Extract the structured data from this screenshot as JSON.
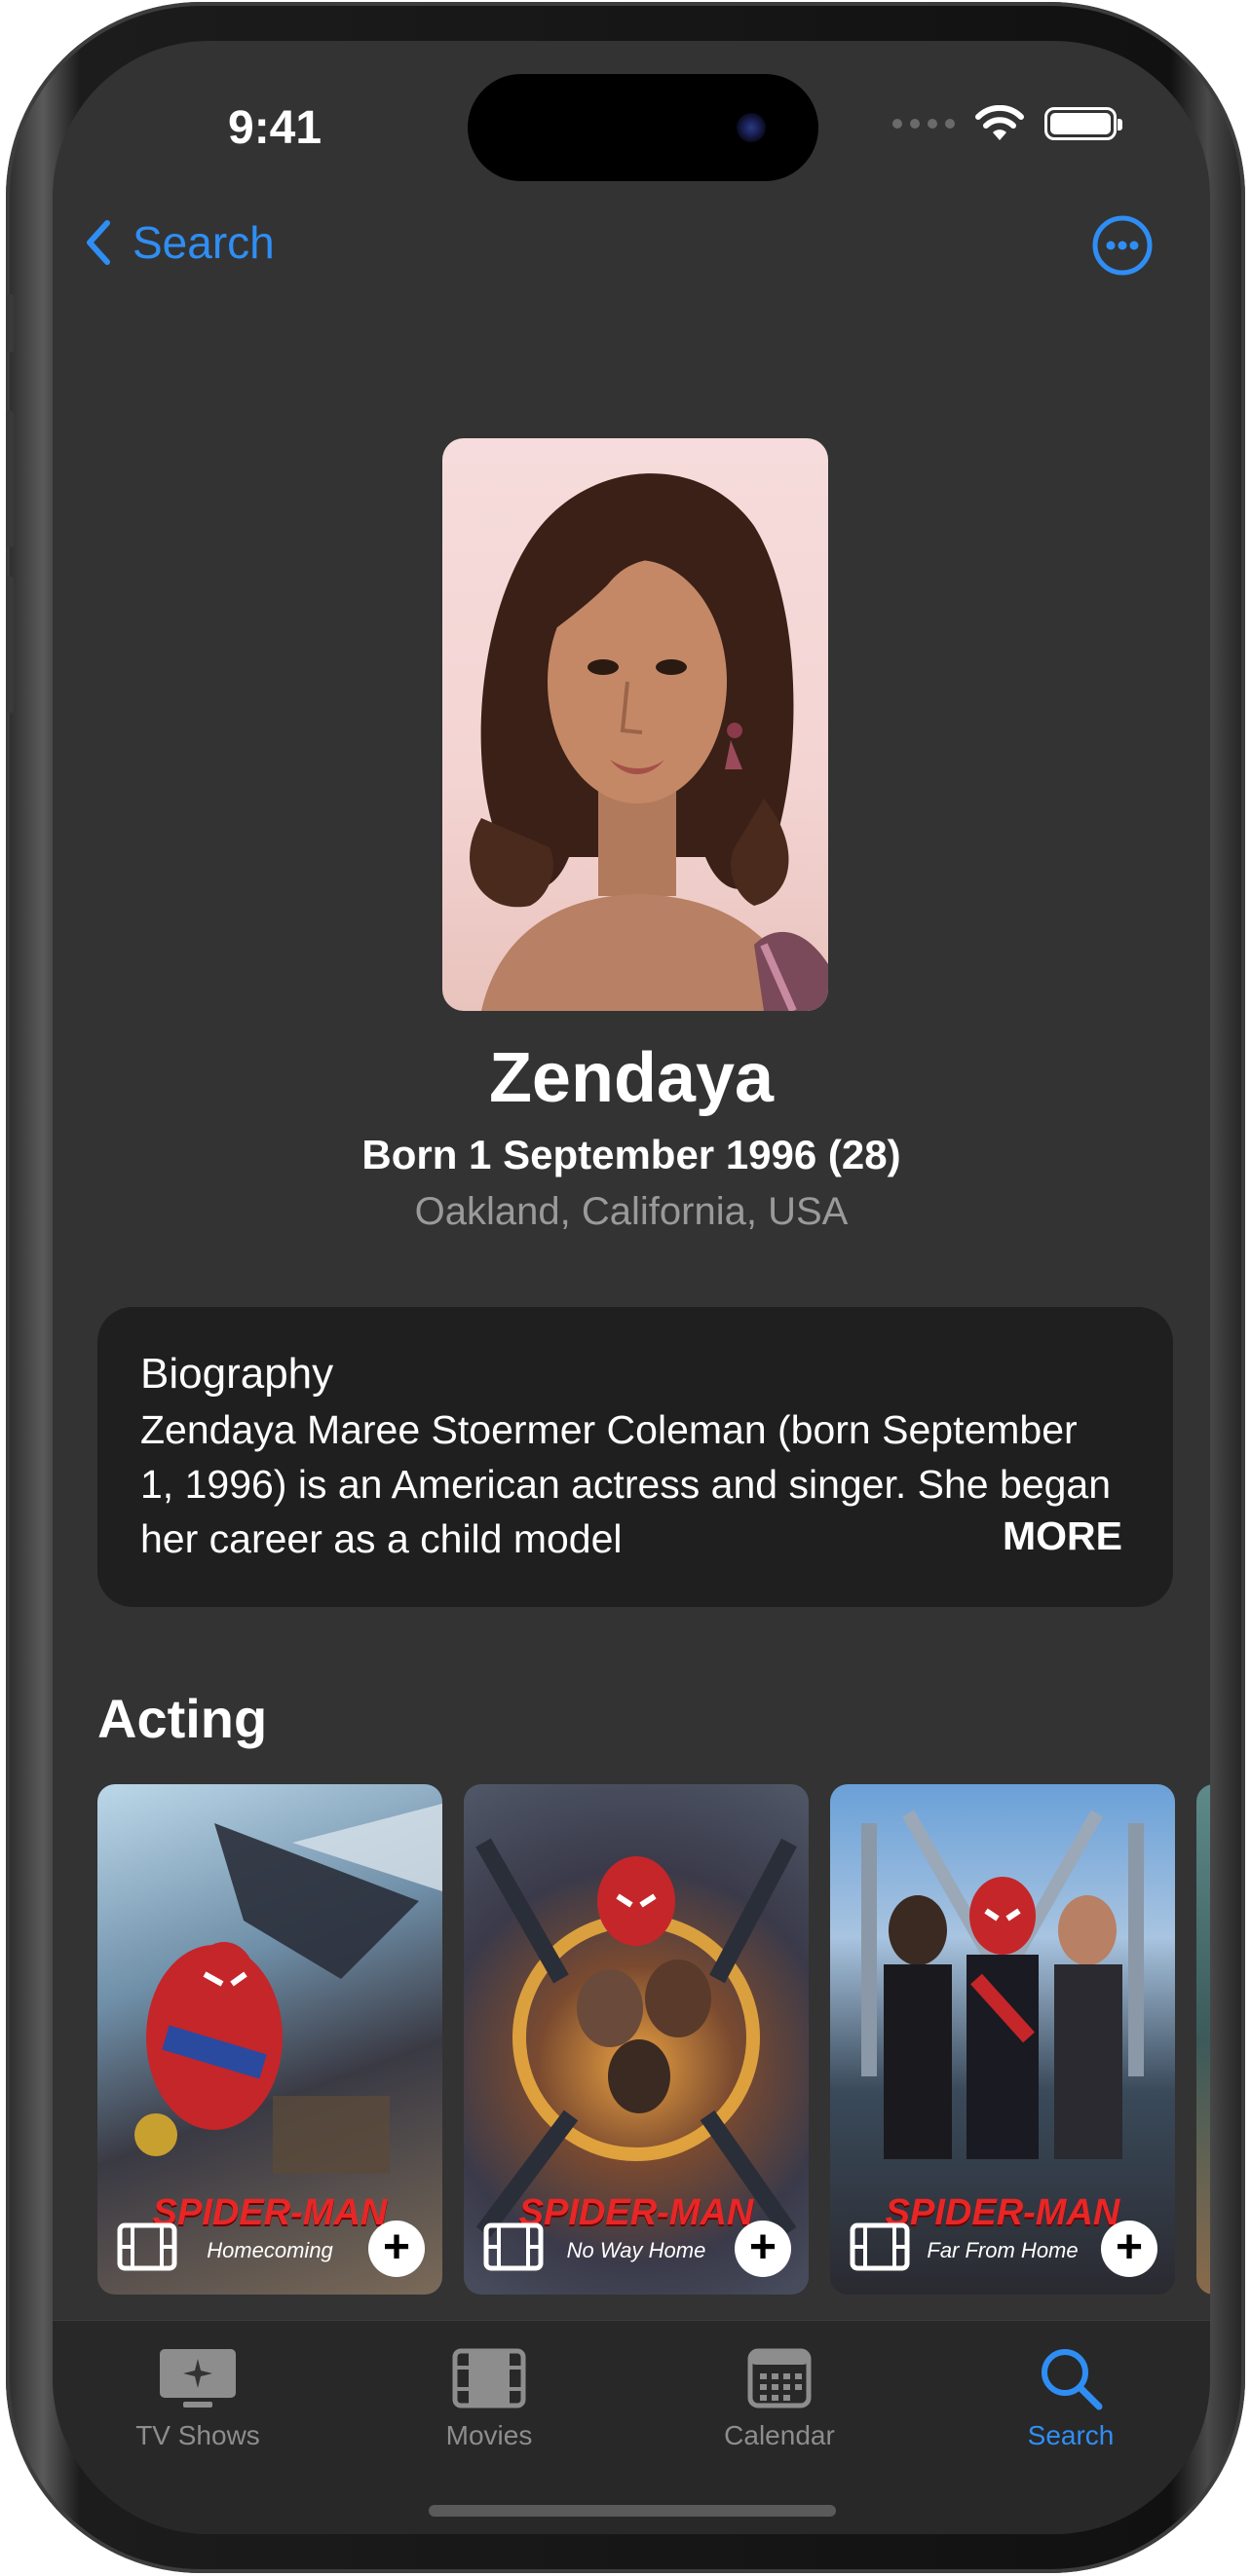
{
  "status_bar": {
    "time": "9:41"
  },
  "nav": {
    "back_label": "Search"
  },
  "person": {
    "name": "Zendaya",
    "born": "Born 1 September 1996 (28)",
    "birthplace": "Oakland, California, USA"
  },
  "biography": {
    "title": "Biography",
    "text": "Zendaya Maree Stoermer Coleman (born September 1, 1996) is an American actress and singer. She began her career as a child model",
    "more_label": "MORE"
  },
  "acting": {
    "title": "Acting",
    "posters": [
      {
        "title": "SPIDER-MAN",
        "subtitle": "Homecoming"
      },
      {
        "title": "SPIDER-MAN",
        "subtitle": "No Way Home"
      },
      {
        "title": "SPIDER-MAN",
        "subtitle": "Far From Home"
      }
    ]
  },
  "tabbar": {
    "items": [
      {
        "label": "TV Shows",
        "icon": "tv-sparkle-icon",
        "active": false
      },
      {
        "label": "Movies",
        "icon": "film-icon",
        "active": false
      },
      {
        "label": "Calendar",
        "icon": "calendar-icon",
        "active": false
      },
      {
        "label": "Search",
        "icon": "search-icon",
        "active": true
      }
    ]
  },
  "colors": {
    "accent": "#2f8ef4",
    "background": "#333333",
    "card": "#1f1f1f"
  }
}
